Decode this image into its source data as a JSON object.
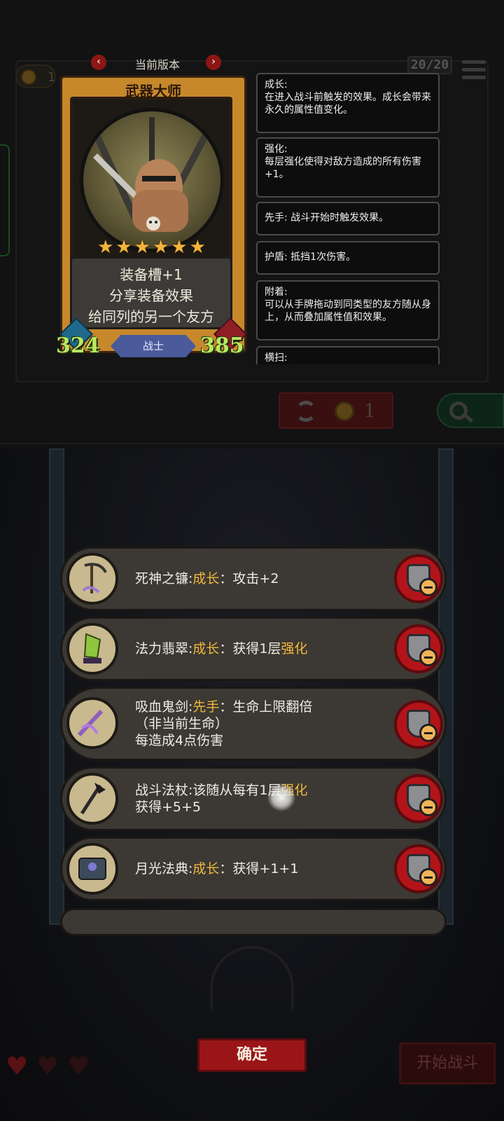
{
  "background": {
    "coin_count": "1",
    "deck_count": "20/20",
    "refresh_cost": "1"
  },
  "card_view": {
    "version_label": "当前版本",
    "card": {
      "name": "武器大师",
      "stars": "★★★★★★",
      "description_lines": [
        "装备槽+1",
        "分享装备效果",
        "给同列的另一个友方"
      ],
      "attack": "324",
      "health": "385",
      "class": "战士"
    },
    "keywords": [
      {
        "title": "成长:",
        "body": "在进入战斗前触发的效果。成长会带来永久的属性值变化。"
      },
      {
        "title": "强化:",
        "body": "每层强化使得对敌方造成的所有伤害+1。"
      },
      {
        "title": "先手: 战斗开始时触发效果。",
        "body": ""
      },
      {
        "title": "护盾: 抵挡1次伤害。",
        "body": ""
      },
      {
        "title": "附着:",
        "body": "可以从手牌拖动到同类型的友方随从身上，从而叠加属性值和效果。"
      },
      {
        "title": "横扫:",
        "body": ""
      }
    ]
  },
  "equipment_list": [
    {
      "name": "死神之镰:",
      "keyword": "成长",
      "after": "：攻击+2",
      "line2": "",
      "line3": "",
      "icon": "scythe-icon"
    },
    {
      "name": "法力翡翠:",
      "keyword": "成长",
      "after": "：获得1层",
      "keyword2": "强化",
      "line2": "",
      "line3": "",
      "icon": "emerald-icon"
    },
    {
      "name": "吸血鬼剑:",
      "keyword": "先手",
      "after": "：生命上限翻倍",
      "line2": "（非当前生命）",
      "line3": "每造成4点伤害",
      "icon": "vampire-sword-icon"
    },
    {
      "name": "战斗法杖:该随从每有1层",
      "keyword": "强化",
      "after": "",
      "line2": "获得+5+5",
      "line3": "",
      "icon": "battle-staff-icon"
    },
    {
      "name": "月光法典:",
      "keyword": "成长",
      "after": "：获得+1+1",
      "line2": "",
      "line3": "",
      "icon": "moonlight-tome-icon"
    }
  ],
  "footer": {
    "confirm_label": "确定",
    "start_battle_label": "开始战斗"
  },
  "colors": {
    "keyword": "#f0b93c",
    "confirm_button": "#9a1518",
    "card_frame": "#c7882c",
    "stat_green": "#b8e860"
  }
}
